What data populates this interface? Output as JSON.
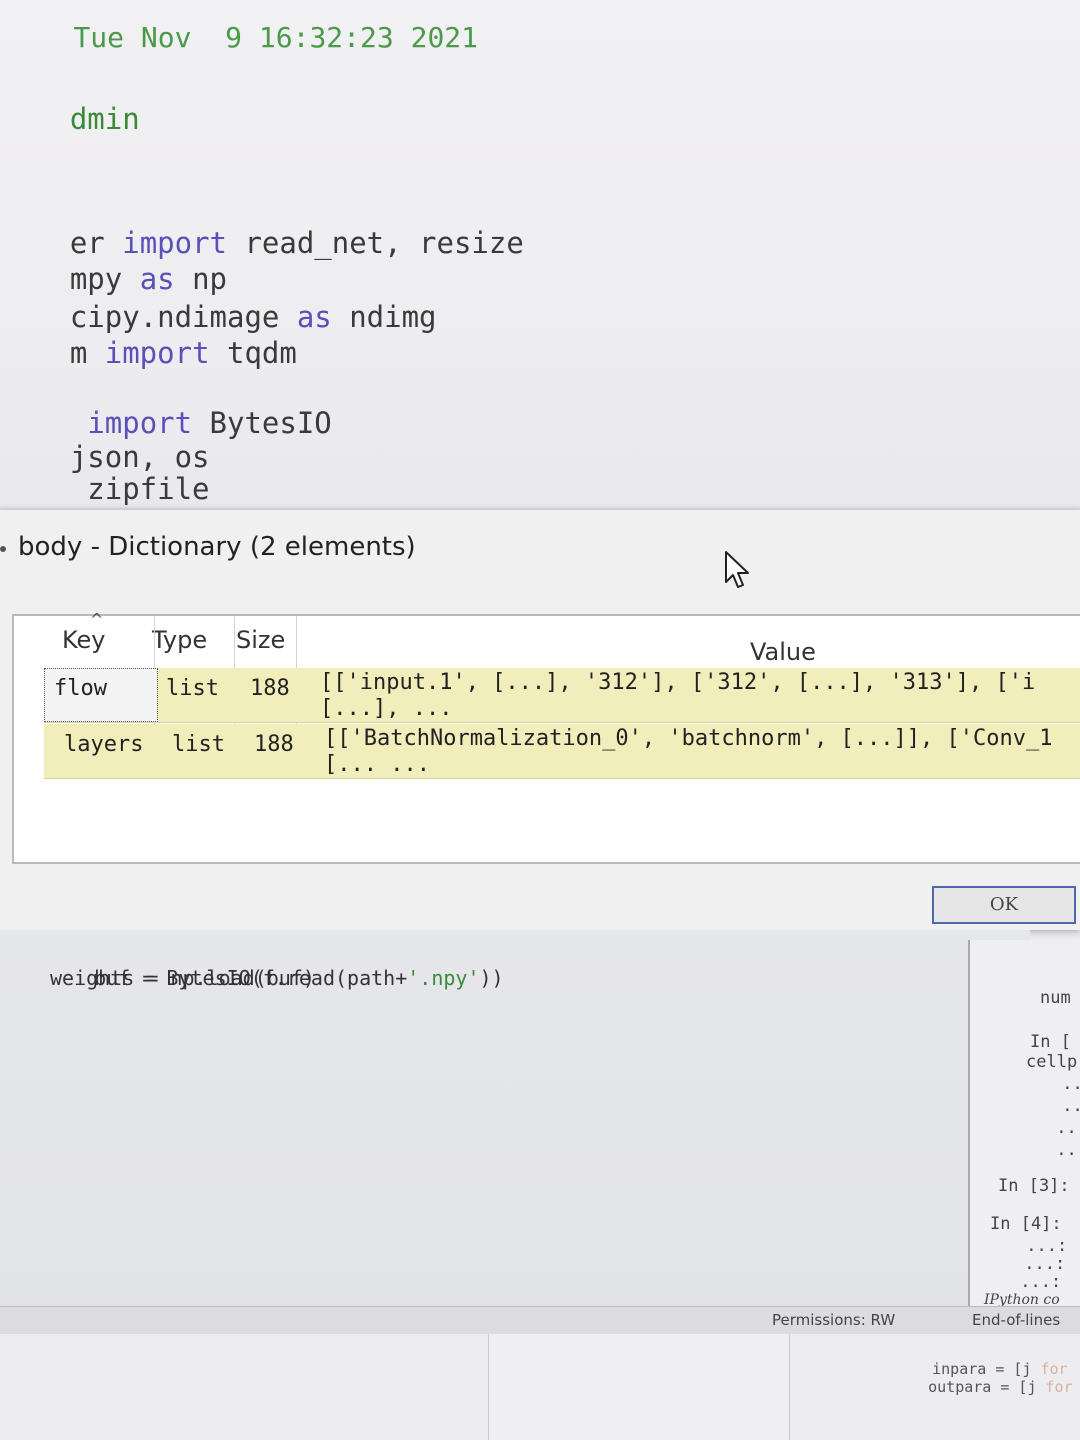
{
  "editor": {
    "lines": [
      {
        "prefix": "Tue Nov  9 16:32:23 2021",
        "kw": "",
        "rest": ""
      },
      {
        "prefix": "dmin",
        "kw": "",
        "rest": ""
      },
      {
        "prefix": "er ",
        "kw": "import",
        "rest": " read_net, resize"
      },
      {
        "prefix": "mpy ",
        "kw": "as",
        "rest": " np"
      },
      {
        "prefix": "cipy.ndimage ",
        "kw": "as",
        "rest": " ndimg"
      },
      {
        "prefix": "m ",
        "kw": "import",
        "rest": " tqdm"
      },
      {
        "prefix": " ",
        "kw": "import",
        "rest": " BytesIO"
      },
      {
        "prefix": "json, os",
        "kw": "",
        "rest": ""
      },
      {
        "prefix": " zipfile",
        "kw": "",
        "rest": ""
      }
    ]
  },
  "dialog": {
    "title": "body - Dictionary (2 elements)",
    "columns": {
      "key": "Key",
      "type": "Type",
      "size": "Size",
      "value": "Value"
    },
    "rows": [
      {
        "key": "flow",
        "type": "list",
        "size": "188",
        "value_line1": "[['input.1', [...], '312'], ['312', [...], '313'], ['i",
        "value_line2": "[...], ..."
      },
      {
        "key": "layers",
        "type": "list",
        "size": "188",
        "value_line1": "[['BatchNormalization_0', 'batchnorm', [...]], ['Conv_1",
        "value_line2": "[... ..."
      }
    ],
    "ok_label": "OK"
  },
  "lower_editor": {
    "line1_pre": "buf = BytesIO(f.read(path+",
    "line1_str": "'.npy'",
    "line1_post": "))",
    "line2": "weights = np.load(buf)"
  },
  "console": {
    "lines": [
      "num",
      "In [",
      "cellp",
      " ..",
      " ..",
      " ...",
      " ...",
      "In [3]:",
      "In [4]:",
      " ...:",
      " ...:",
      " ...:"
    ],
    "footer": "IPython co"
  },
  "statusbar": {
    "permissions": "Permissions: RW",
    "eol": "End-of-lines"
  },
  "bottom": {
    "line1_pre": "inpara = [j ",
    "line1_kw": "for",
    "line2_pre": "outpara = [j ",
    "line2_kw": "for"
  }
}
